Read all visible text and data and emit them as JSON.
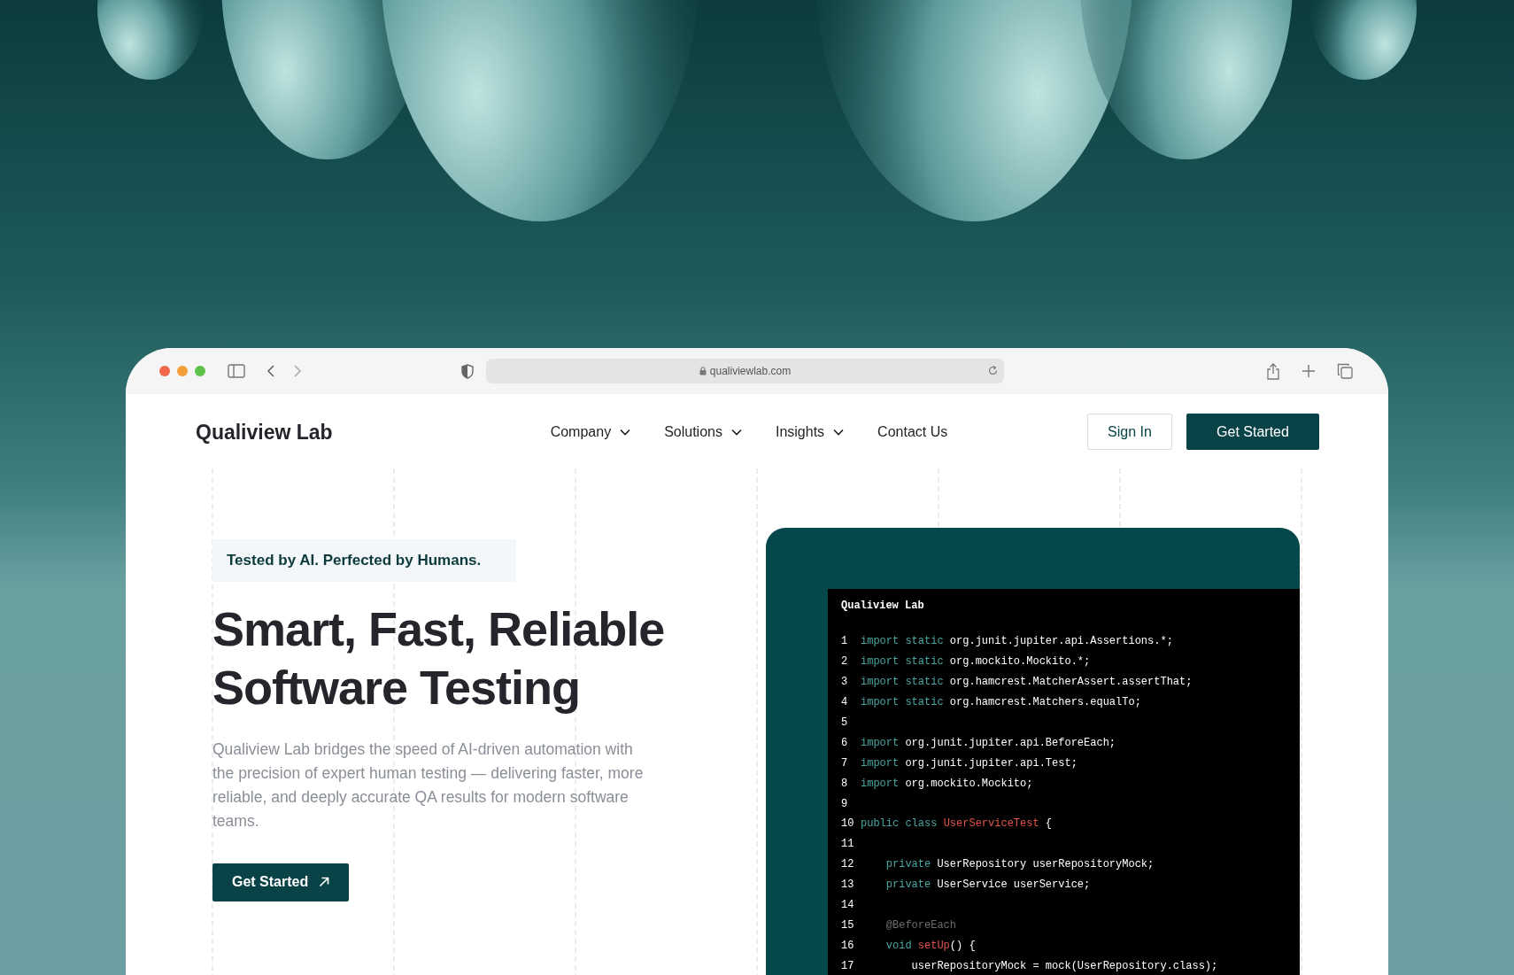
{
  "browser": {
    "url": "qualiviewlab.com"
  },
  "site": {
    "logo": "Qualiview Lab",
    "nav": [
      {
        "label": "Company",
        "has_menu": true
      },
      {
        "label": "Solutions",
        "has_menu": true
      },
      {
        "label": "Insights",
        "has_menu": true
      },
      {
        "label": "Contact Us",
        "has_menu": false
      }
    ],
    "sign_in": "Sign In",
    "get_started": "Get Started"
  },
  "hero": {
    "tagline": "Tested by AI. Perfected by Humans.",
    "heading": [
      "Smart, Fast, Reliable",
      "Software Testing"
    ],
    "description": "Qualiview Lab bridges the speed of AI-driven automation with the precision of expert human testing — delivering faster, more reliable, and deeply accurate QA results for modern software teams.",
    "button": "Get Started"
  },
  "code_panel": {
    "title": "Qualiview Lab",
    "lines": [
      {
        "number": "1",
        "tokens": [
          {
            "kind": "keyword",
            "text": "import static"
          },
          {
            "kind": "plain",
            "text": " org.junit.jupiter.api.Assertions.*;"
          }
        ]
      },
      {
        "number": "2",
        "tokens": [
          {
            "kind": "keyword",
            "text": "import static"
          },
          {
            "kind": "plain",
            "text": " org.mockito.Mockito.*;"
          }
        ]
      },
      {
        "number": "3",
        "tokens": [
          {
            "kind": "keyword",
            "text": "import static"
          },
          {
            "kind": "plain",
            "text": " org.hamcrest.MatcherAssert.assertThat;"
          }
        ]
      },
      {
        "number": "4",
        "tokens": [
          {
            "kind": "keyword",
            "text": "import static"
          },
          {
            "kind": "plain",
            "text": " org.hamcrest.Matchers.equalTo;"
          }
        ]
      },
      {
        "number": "5"
      },
      {
        "number": "6",
        "tokens": [
          {
            "kind": "keyword",
            "text": "import"
          },
          {
            "kind": "plain",
            "text": " org.junit.jupiter.api.BeforeEach;"
          }
        ]
      },
      {
        "number": "7",
        "tokens": [
          {
            "kind": "keyword",
            "text": "import"
          },
          {
            "kind": "plain",
            "text": " org.junit.jupiter.api.Test;"
          }
        ]
      },
      {
        "number": "8",
        "tokens": [
          {
            "kind": "keyword",
            "text": "import"
          },
          {
            "kind": "plain",
            "text": " org.mockito.Mockito;"
          }
        ]
      },
      {
        "number": "9"
      },
      {
        "number": "10",
        "tokens": [
          {
            "kind": "keyword",
            "text": "public class "
          },
          {
            "kind": "name",
            "text": "UserServiceTest"
          },
          {
            "kind": "plain",
            "text": " {"
          }
        ]
      },
      {
        "number": "11"
      },
      {
        "number": "12",
        "tokens": [
          {
            "kind": "keyword",
            "text": "    private"
          },
          {
            "kind": "plain",
            "text": " UserRepository userRepositoryMock;"
          }
        ]
      },
      {
        "number": "13",
        "tokens": [
          {
            "kind": "keyword",
            "text": "    private"
          },
          {
            "kind": "plain",
            "text": " UserService userService;"
          }
        ]
      },
      {
        "number": "14"
      },
      {
        "number": "15",
        "tokens": [
          {
            "kind": "annotation",
            "text": "    @BeforeEach"
          }
        ]
      },
      {
        "number": "16",
        "tokens": [
          {
            "kind": "keyword",
            "text": "    void "
          },
          {
            "kind": "name",
            "text": "setUp"
          },
          {
            "kind": "plain",
            "text": "() {"
          }
        ]
      },
      {
        "number": "17",
        "tokens": [
          {
            "kind": "plain",
            "text": "        userRepositoryMock = mock(UserRepository.class);"
          }
        ]
      }
    ]
  }
}
